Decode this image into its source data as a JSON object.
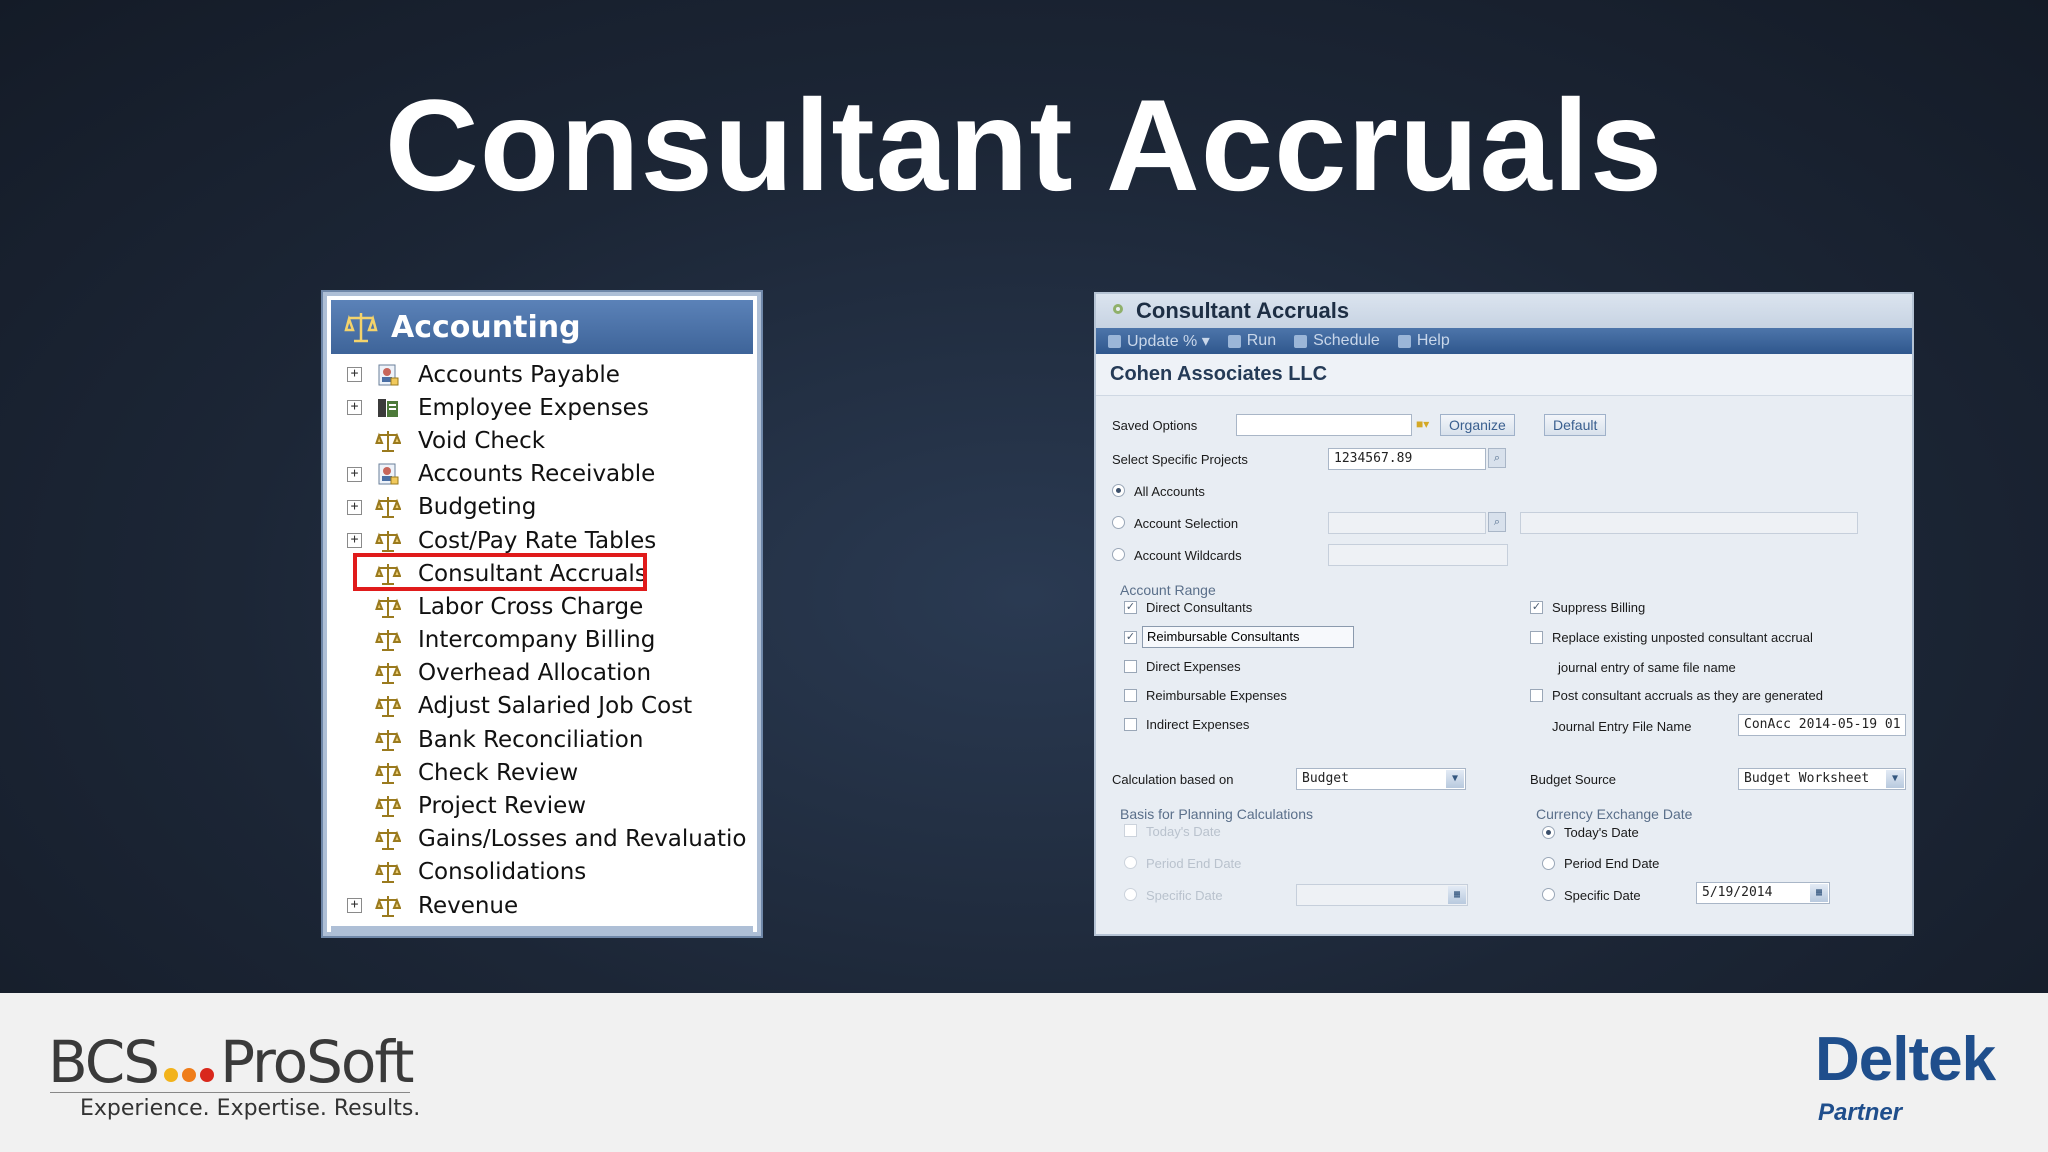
{
  "slide": {
    "title": "Consultant Accruals"
  },
  "accounting_panel": {
    "header": "Accounting",
    "items": [
      {
        "label": "Accounts Payable",
        "expandable": true,
        "icon": "person-invoice-icon"
      },
      {
        "label": "Employee Expenses",
        "expandable": true,
        "icon": "ledger-icon"
      },
      {
        "label": "Void Check",
        "expandable": false,
        "icon": "scale-icon"
      },
      {
        "label": "Accounts Receivable",
        "expandable": true,
        "icon": "person-invoice-icon"
      },
      {
        "label": "Budgeting",
        "expandable": true,
        "icon": "scale-icon"
      },
      {
        "label": "Cost/Pay Rate Tables",
        "expandable": true,
        "icon": "scale-icon"
      },
      {
        "label": "Consultant Accruals",
        "expandable": false,
        "icon": "scale-icon"
      },
      {
        "label": "Labor Cross Charge",
        "expandable": false,
        "icon": "scale-icon"
      },
      {
        "label": "Intercompany Billing",
        "expandable": false,
        "icon": "scale-icon"
      },
      {
        "label": "Overhead Allocation",
        "expandable": false,
        "icon": "scale-icon"
      },
      {
        "label": "Adjust Salaried Job Cost",
        "expandable": false,
        "icon": "scale-icon"
      },
      {
        "label": "Bank Reconciliation",
        "expandable": false,
        "icon": "scale-icon"
      },
      {
        "label": "Check Review",
        "expandable": false,
        "icon": "scale-icon"
      },
      {
        "label": "Project Review",
        "expandable": false,
        "icon": "scale-icon"
      },
      {
        "label": "Gains/Losses and Revaluatio",
        "expandable": false,
        "icon": "scale-icon"
      },
      {
        "label": "Consolidations",
        "expandable": false,
        "icon": "scale-icon"
      },
      {
        "label": "Revenue",
        "expandable": true,
        "icon": "scale-icon"
      }
    ],
    "expand_glyph": "+"
  },
  "form": {
    "title": "Consultant Accruals",
    "toolbar": {
      "update": "Update % ▾",
      "run": "Run",
      "schedule": "Schedule",
      "help": "Help"
    },
    "company": "Cohen Associates LLC",
    "saved_options_label": "Saved Options",
    "organize": "Organize",
    "default": "Default",
    "select_projects_label": "Select Specific Projects",
    "select_projects_value": "1234567.89",
    "all_accounts": "All Accounts",
    "account_selection": "Account Selection",
    "account_wildcards": "Account Wildcards",
    "account_range": "Account Range",
    "direct_consultants": "Direct Consultants",
    "reimbursable_consultants": "Reimbursable Consultants",
    "direct_expenses": "Direct Expenses",
    "reimbursable_expenses": "Reimbursable Expenses",
    "indirect_expenses": "Indirect Expenses",
    "suppress_billing": "Suppress Billing",
    "replace_existing": "Replace existing unposted consultant accrual",
    "replace_existing_2": "journal entry of same file name",
    "post_accruals": "Post consultant accruals as they are generated",
    "je_file_label": "Journal Entry File Name",
    "je_file_value": "ConAcc 2014-05-19 01",
    "calc_based_label": "Calculation based on",
    "calc_based_value": "Budget",
    "budget_source_label": "Budget Source",
    "budget_source_value": "Budget Worksheet",
    "basis_label": "Basis for Planning Calculations",
    "basis_today": "Today's Date",
    "basis_period_end": "Period End Date",
    "basis_specific": "Specific Date",
    "currency_label": "Currency Exchange Date",
    "cur_today": "Today's Date",
    "cur_period_end": "Period End Date",
    "cur_specific": "Specific Date",
    "cur_specific_value": "5/19/2014"
  },
  "footer": {
    "bcs_left": "BCS",
    "bcs_right": "ProSoft",
    "tagline": "Experience. Expertise. Results.",
    "deltek": "Deltek",
    "partner": "Partner",
    "dot_colors": [
      "#f2b31b",
      "#ef7d1a",
      "#d9281c"
    ]
  },
  "colors": {
    "highlight": "#e01b1b",
    "brand_blue": "#1f4e8c"
  }
}
